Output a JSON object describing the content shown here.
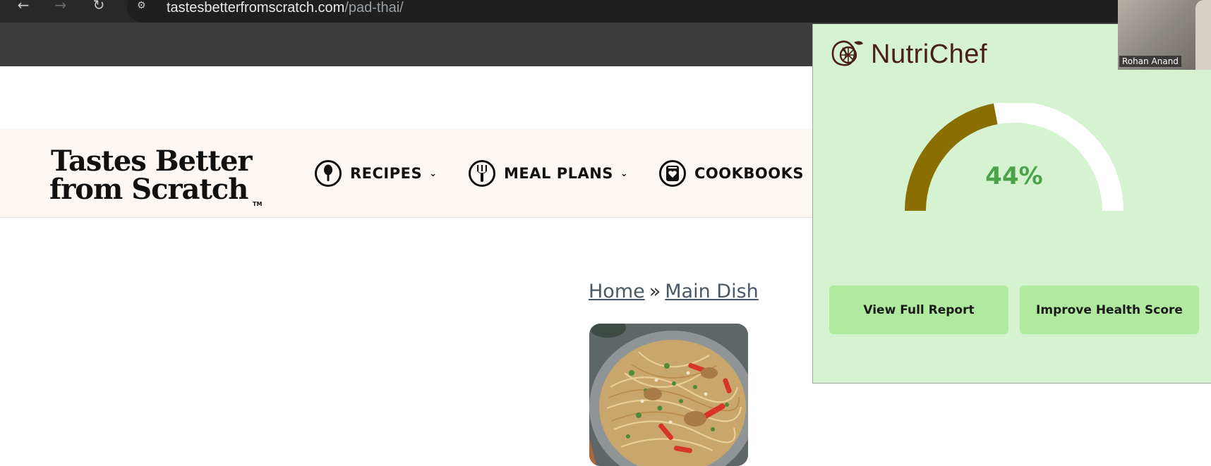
{
  "browser": {
    "back_icon": "arrow-left-icon",
    "forward_icon": "arrow-right-icon",
    "reload_icon": "reload-icon",
    "site_info_icon": "tune-icon",
    "url_host": "tastesbetterfromscratch.com",
    "url_path": "/pad-thai/"
  },
  "site": {
    "logo_line1": "Tastes Better",
    "logo_line2": "from Scratch",
    "logo_tm": "TM",
    "nav": [
      {
        "label": "RECIPES",
        "icon": "spoon-icon"
      },
      {
        "label": "MEAL PLANS",
        "icon": "fork-icon"
      },
      {
        "label": "COOKBOOKS",
        "icon": "cookbook-icon"
      }
    ]
  },
  "breadcrumb": {
    "home": "Home",
    "separator": "»",
    "category": "Main Dish"
  },
  "nutrichef": {
    "brand": "NutriChef",
    "logo_icon": "lemon-leaf-icon",
    "score_percent": 44,
    "score_label": "44%",
    "colors": {
      "gauge_fill": "#8b6e00",
      "gauge_track": "#ffffff",
      "score_text": "#4aa34a",
      "panel_bg": "#d5f3d0",
      "button_bg": "#b0ea9f"
    },
    "buttons": {
      "report": "View Full Report",
      "improve": "Improve Health Score"
    }
  },
  "video": {
    "name": "Rohan Anand"
  }
}
